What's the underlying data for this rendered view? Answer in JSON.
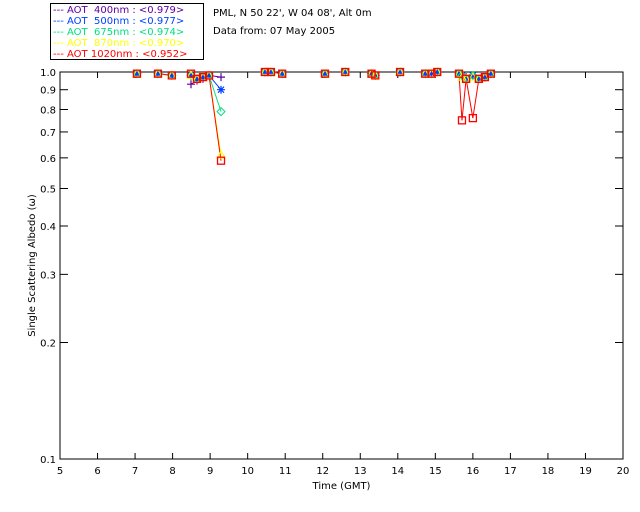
{
  "header": {
    "location": "PML, N 50 22', W 04 08', Alt 0m",
    "date_line": "Data from: 07 May 2005"
  },
  "chart_data": {
    "type": "scatter",
    "title": "",
    "xlabel": "Time (GMT)",
    "ylabel": "Single Scattering Albedo (ω)",
    "xlim": [
      5,
      20
    ],
    "ylim": [
      0.1,
      1.0
    ],
    "yscale": "log",
    "x_ticks": [
      "5",
      "6",
      "7",
      "8",
      "9",
      "10",
      "11",
      "12",
      "13",
      "14",
      "15",
      "16",
      "17",
      "18",
      "19",
      "20"
    ],
    "y_ticks": [
      "0.1",
      "0.2",
      "0.3",
      "0.4",
      "0.5",
      "0.6",
      "0.7",
      "0.8",
      "0.9",
      "1.0"
    ],
    "grid": false,
    "legend_position": "top-left outside",
    "x": [
      7.05,
      7.61,
      7.98,
      8.49,
      8.65,
      8.81,
      8.97,
      9.29,
      10.46,
      10.62,
      10.92,
      12.06,
      12.6,
      13.3,
      13.4,
      14.06,
      14.73,
      14.9,
      15.05,
      15.63,
      15.71,
      15.82,
      16.0,
      16.16,
      16.32,
      16.48
    ],
    "series": [
      {
        "name": "AOT  400nm : <0.979>",
        "color": "#6000a0",
        "marker": "plus",
        "values": [
          0.99,
          0.99,
          0.98,
          0.93,
          0.95,
          0.96,
          0.98,
          0.97,
          1.0,
          1.0,
          0.99,
          0.99,
          1.0,
          0.99,
          0.98,
          1.0,
          0.99,
          0.99,
          1.0,
          0.99,
          0.98,
          0.97,
          0.98,
          0.96,
          0.97,
          0.99
        ]
      },
      {
        "name": "AOT  500nm : <0.977>",
        "color": "#0040ff",
        "marker": "asterisk",
        "values": [
          0.99,
          0.99,
          0.98,
          0.98,
          0.96,
          0.97,
          0.98,
          0.9,
          1.0,
          1.0,
          0.99,
          0.99,
          1.0,
          0.99,
          0.98,
          1.0,
          0.99,
          0.99,
          1.0,
          0.99,
          0.98,
          0.96,
          0.98,
          0.96,
          0.97,
          0.99
        ]
      },
      {
        "name": "AOT  675nm : <0.974>",
        "color": "#00e080",
        "marker": "diamond",
        "values": [
          0.99,
          0.99,
          0.98,
          0.98,
          0.96,
          0.97,
          0.98,
          0.79,
          1.0,
          1.0,
          0.99,
          0.99,
          1.0,
          0.99,
          0.98,
          1.0,
          0.99,
          0.99,
          1.0,
          0.99,
          0.98,
          0.96,
          0.98,
          0.96,
          0.97,
          0.99
        ]
      },
      {
        "name": "AOT  870nm : <0.970>",
        "color": "#ffff00",
        "marker": "triangle",
        "values": [
          0.99,
          0.99,
          0.98,
          0.98,
          0.96,
          0.97,
          0.98,
          0.61,
          1.0,
          1.0,
          0.99,
          0.99,
          1.0,
          0.99,
          0.98,
          1.0,
          0.99,
          0.99,
          1.0,
          0.99,
          0.97,
          0.96,
          0.97,
          0.96,
          0.97,
          0.99
        ]
      },
      {
        "name": "AOT 1020nm : <0.952>",
        "color": "#ff0000",
        "marker": "square",
        "values": [
          0.99,
          0.99,
          0.98,
          0.99,
          0.96,
          0.97,
          0.98,
          0.59,
          1.0,
          1.0,
          0.99,
          0.99,
          1.0,
          0.99,
          0.98,
          1.0,
          0.99,
          0.99,
          1.0,
          0.99,
          0.75,
          0.96,
          0.76,
          0.96,
          0.97,
          0.99
        ]
      }
    ]
  }
}
